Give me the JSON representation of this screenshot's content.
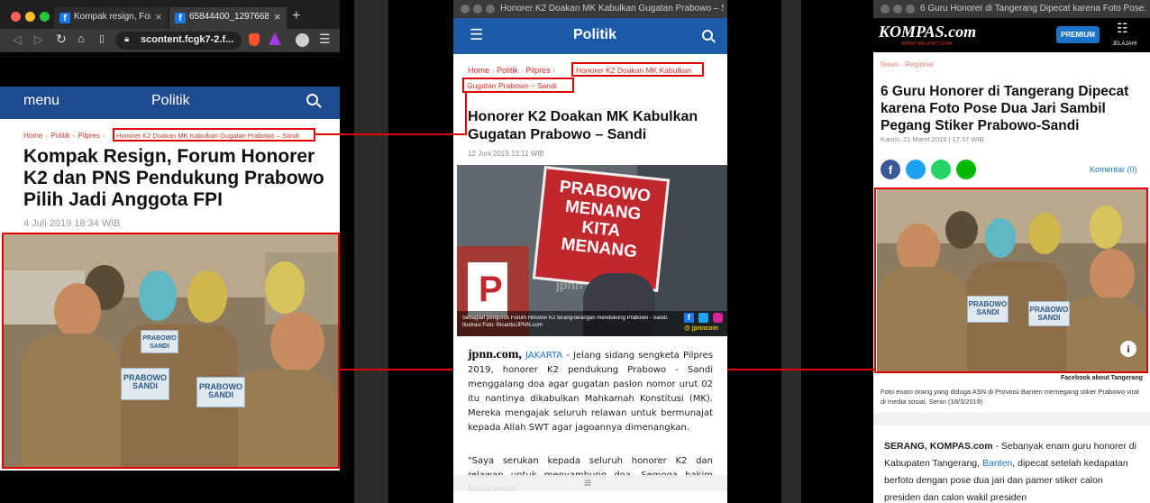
{
  "win1": {
    "tab1": "Kompak resign, Foru",
    "tab2": "65844400_1297668",
    "url": "scontent.fcgk7-2.f...",
    "nav_menu": "menu",
    "nav_section": "Politik",
    "breadcrumb": [
      "Home",
      "Politik",
      "Pilpres",
      "Honorer K2 Doakan MK Kabulkan Gugatan Prabowo – Sandi"
    ],
    "title": "Kompak Resign, Forum Honorer K2 dan PNS Pendukung Prabowo Pilih Jadi Anggota FPI",
    "date": "4 Juli 2019 18:34 WIB",
    "sign_text": "PRABOWO SANDI"
  },
  "win2": {
    "window_title": "Honorer K2 Doakan MK Kabulkan Gugatan Prabowo – S...",
    "nav_section": "Politik",
    "breadcrumb": [
      "Home",
      "Politik",
      "Pilpres",
      "Honorer K2 Doakan MK Kabulkan",
      "Gugatan Prabowo – Sandi"
    ],
    "title": "Honorer K2 Doakan MK Kabulkan Gugatan Prabowo – Sandi",
    "date": "12 Juni 2019 13:11 WIB",
    "poster_lines": [
      "PRABOWO",
      "MENANG",
      "KITA",
      "MENANG"
    ],
    "watermark": "jpnn",
    "caption_line1": "Sebagian pengurus Forum Honorer K2 terang-terangan mendukung Prabowo - Sandi.",
    "caption_line2": "Ilustrasi Foto: Ricardo/JPNN.com",
    "caption_credit": "@ jpnncom",
    "dateline_source": "jpnn.com,",
    "dateline_city": "JAKARTA",
    "para1_rest": "- Jelang sidang sengketa Pilpres 2019, honorer K2 pendukung Prabowo - Sandi menggalang doa agar gugatan paslon nomor urut 02 itu nantinya dikabulkan Mahkamah Konstitusi (MK). Mereka mengajak seluruh relawan untuk bermunajat kepada Allah SWT agar jagoannya dimenangkan.",
    "para2": "\"Saya serukan kepada seluruh honorer K2 dan relawan untuk menyambung doa. Semoga hakim Mahkamah"
  },
  "win3": {
    "window_title": "6 Guru Honorer di Tangerang Dipecat karena Foto Pose...",
    "logo": "KOMPAS.com",
    "logo_tagline": "JERNIH MELIHAT DUNIA",
    "premium": "PREMIUM",
    "explore": "JELAJAHI",
    "breadcrumb": [
      "News",
      "Regional"
    ],
    "title": "6 Guru Honorer di Tangerang Dipecat karena Foto Pose Dua Jari Sambil Pegang Stiker Prabowo-Sandi",
    "date": "Kamis, 21 Maret 2019 | 17:37 WIB",
    "comments": "Komentar (0)",
    "photo_credit": "Facebook about Tangerang",
    "caption": "Foto enam orang yang diduga ASN di Provinsi Banten memegang stiker Prabowo viral di media sosial, Senin (18/3/2019)",
    "body_source": "SERANG, KOMPAS.com",
    "body_1": "- Sebanyak enam guru honorer di Kabupaten Tangerang,",
    "body_link": "Banten",
    "body_2": ", dipecat setelah kedapatan berfoto dengan pose dua jari dan pamer stiker calon presiden dan calon wakil presiden"
  },
  "colors": {
    "red_highlight": "#e00000",
    "tribun_blue": "#1e4b8f",
    "jpnn_blue": "#1a5aa6",
    "kompas_blue": "#1a73c8"
  }
}
